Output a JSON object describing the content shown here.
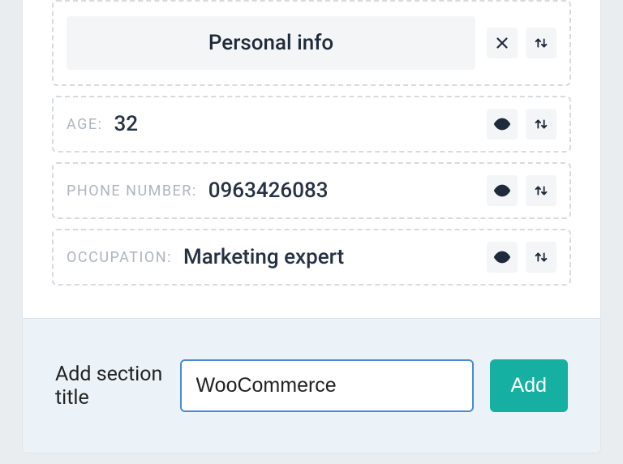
{
  "header": {
    "title": "Personal info"
  },
  "fields": [
    {
      "label": "AGE:",
      "value": "32"
    },
    {
      "label": "PHONE NUMBER:",
      "value": "0963426083"
    },
    {
      "label": "OCCUPATION:",
      "value": "Marketing expert"
    }
  ],
  "add_section": {
    "prompt": "Add section title",
    "input_value": "WooCommerce",
    "button_label": "Add"
  },
  "icons": {
    "close": "close-icon",
    "sort": "sort-icon",
    "visibility": "eye-icon"
  }
}
